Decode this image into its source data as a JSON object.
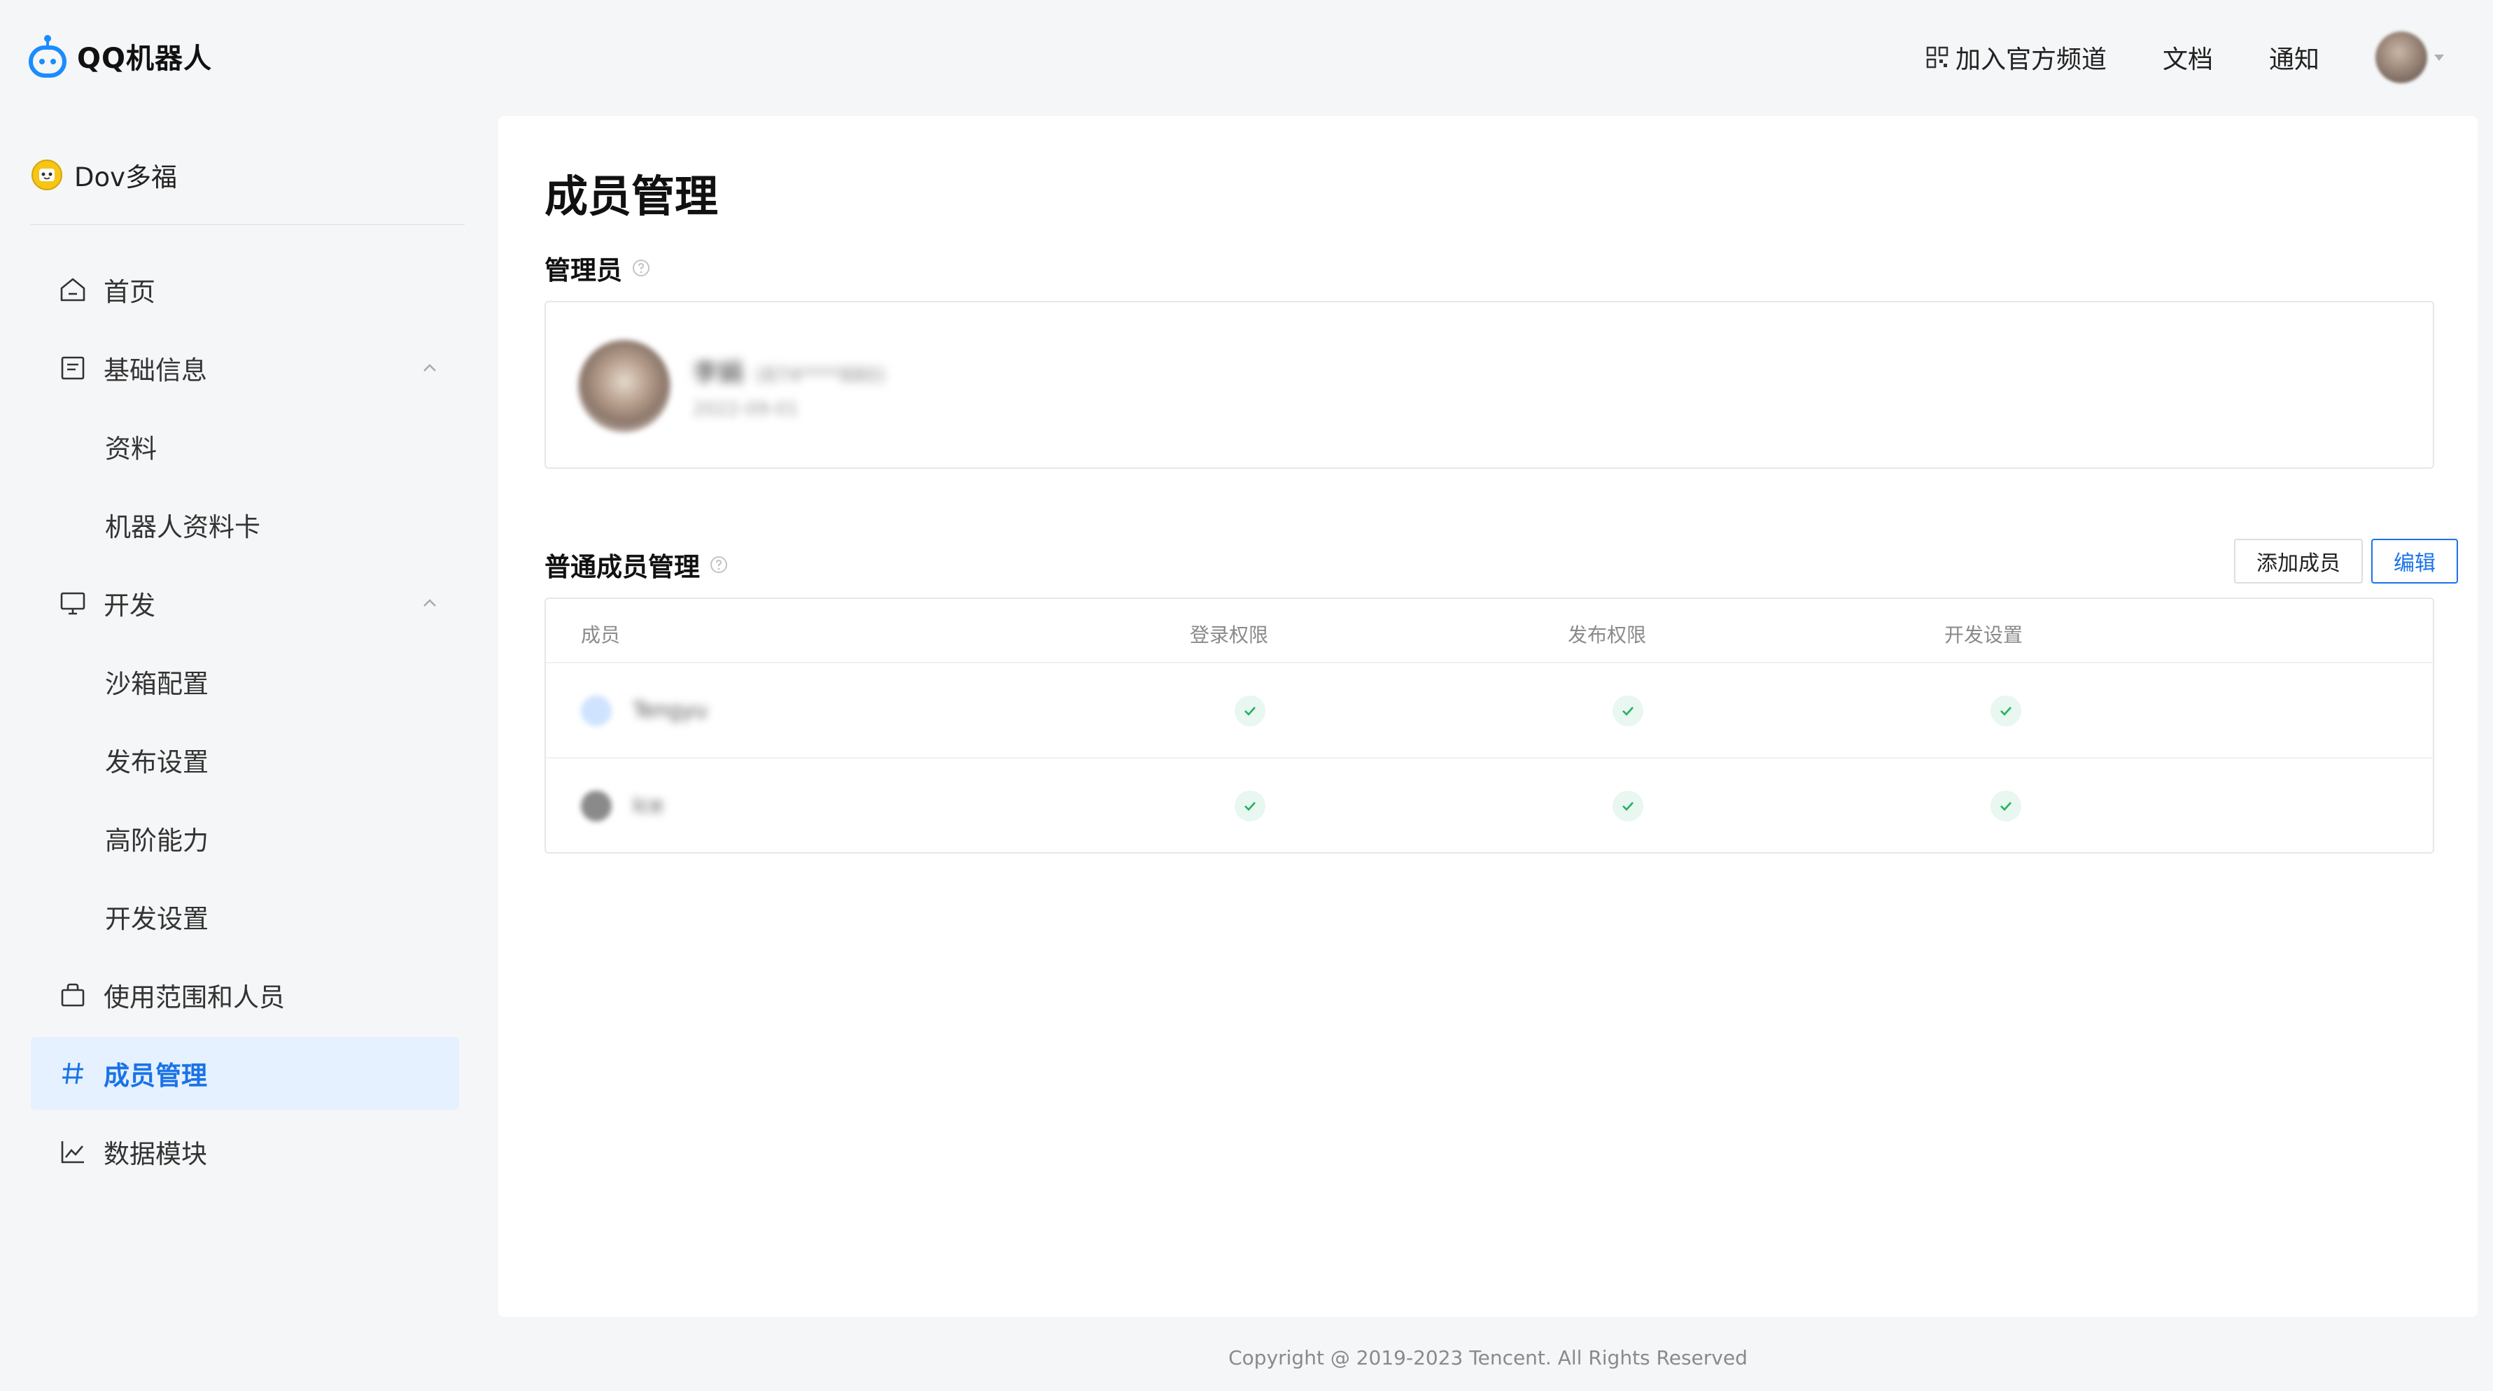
{
  "header": {
    "logo_text": "QQ机器人",
    "nav": {
      "join_channel": "加入官方频道",
      "docs": "文档",
      "notify": "通知"
    }
  },
  "sidebar": {
    "bot_name": "Dov多福",
    "items": [
      {
        "label": "首页",
        "icon": "home-icon"
      },
      {
        "label": "基础信息",
        "icon": "document-icon"
      },
      {
        "label": "资料"
      },
      {
        "label": "机器人资料卡"
      },
      {
        "label": "开发",
        "icon": "monitor-icon"
      },
      {
        "label": "沙箱配置"
      },
      {
        "label": "发布设置"
      },
      {
        "label": "高阶能力"
      },
      {
        "label": "开发设置"
      },
      {
        "label": "使用范围和人员",
        "icon": "bag-icon"
      },
      {
        "label": "成员管理",
        "icon": "hash-icon"
      },
      {
        "label": "数据模块",
        "icon": "chart-line-icon"
      }
    ]
  },
  "main": {
    "title": "成员管理",
    "admin_section": {
      "title": "管理员",
      "admin": {
        "name": "李娟",
        "id": "(874****880)",
        "date": "2022-09-01"
      }
    },
    "members_section": {
      "title": "普通成员管理",
      "add_label": "添加成员",
      "edit_label": "编辑",
      "columns": [
        "成员",
        "登录权限",
        "发布权限",
        "开发设置"
      ],
      "rows": [
        {
          "name": "Tengyu",
          "login": true,
          "publish": true,
          "dev": true
        },
        {
          "name": "Ice",
          "login": true,
          "publish": true,
          "dev": true
        }
      ]
    }
  },
  "footer": {
    "copyright": "Copyright @ 2019-2023 Tencent. All Rights Reserved"
  },
  "colors": {
    "accent": "#1a73e8",
    "active_bg": "#e6f1ff",
    "check": "#27ae60"
  }
}
